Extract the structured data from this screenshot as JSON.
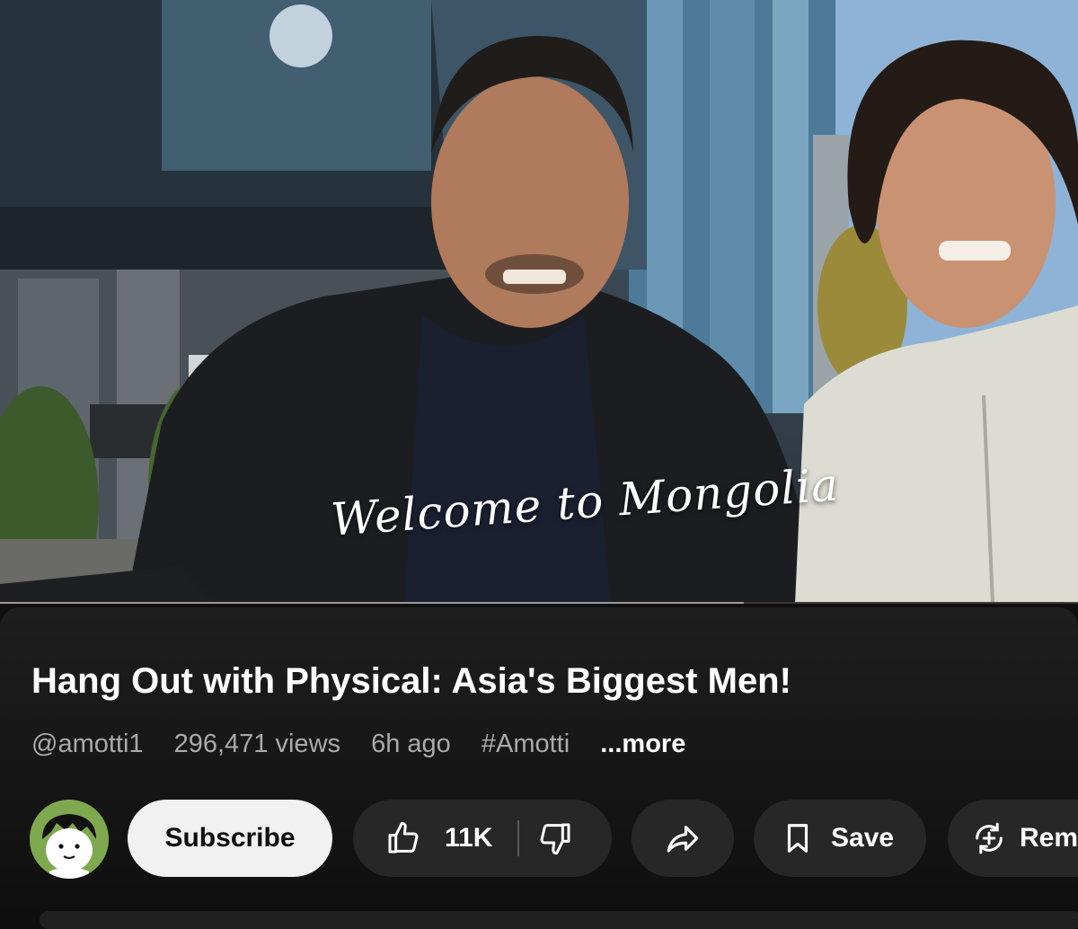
{
  "video": {
    "overlay_caption": "Welcome to Mongolia",
    "progress_fraction": 0.69
  },
  "info": {
    "title": "Hang Out with Physical: Asia's Biggest Men!",
    "channel_handle": "@amotti1",
    "views": "296,471 views",
    "age": "6h ago",
    "hashtag": "#Amotti",
    "more_label": "...more"
  },
  "actions": {
    "subscribe_label": "Subscribe",
    "like_count": "11K",
    "save_label": "Save",
    "remix_label": "Rem"
  },
  "icons": {
    "like": "thumbs-up-icon",
    "dislike": "thumbs-down-icon",
    "share": "share-arrow-icon",
    "save": "bookmark-icon",
    "remix": "remix-icon"
  },
  "colors": {
    "background": "#0f0f0f",
    "pill": "#272727",
    "subscribe_bg": "#f1f1f1",
    "avatar_bg": "#7fa94f",
    "meta_text": "#aaaaaa"
  }
}
